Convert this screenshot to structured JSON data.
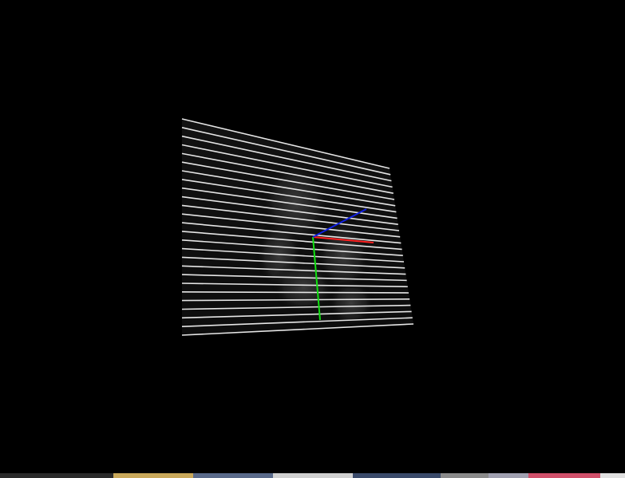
{
  "viewer": {
    "background_color": "#000000",
    "slice_line_color": "#e6e6e6",
    "slice_count": 26,
    "axes": {
      "x": {
        "color": "#ff2020"
      },
      "y": {
        "color": "#10e010"
      },
      "z": {
        "color": "#1020e0"
      }
    }
  },
  "taskbar": {
    "thumbnail_colors": [
      "#2a2a2a",
      "#c9a85a",
      "#5a6a8a",
      "#d0d0d0",
      "#3a4a6a",
      "#8a8a8a",
      "#a0a0b0",
      "#d0506a",
      "#e0e0e0"
    ]
  }
}
